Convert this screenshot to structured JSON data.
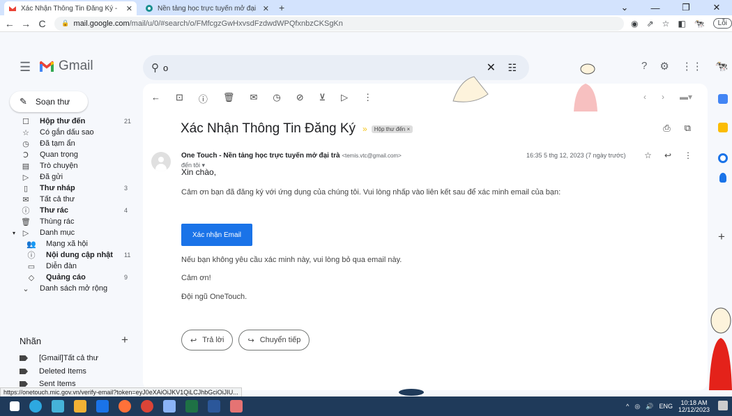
{
  "browser": {
    "tabs": [
      {
        "title": "Xác Nhận Thông Tin Đăng Ký - ",
        "active": true
      },
      {
        "title": "Nền tảng học trực tuyến mở đại",
        "active": false
      }
    ],
    "url_host": "mail.google.com",
    "url_path": "/mail/u/0/#search/o/FMfcgzGwHxvsdFzdwdWPQfxnbzCKSgKn",
    "error_button": "Lỗi"
  },
  "gmail": {
    "logo_text": "Gmail",
    "search_value": "o",
    "compose_label": "Soạn thư",
    "nav": [
      {
        "icon": "inbox-icon",
        "glyph": "☐",
        "label": "Hộp thư đến",
        "count": "21",
        "bold": true
      },
      {
        "icon": "star-icon",
        "glyph": "☆",
        "label": "Có gắn dấu sao",
        "count": "",
        "bold": false
      },
      {
        "icon": "clock-icon",
        "glyph": "◷",
        "label": "Đã tạm ẩn",
        "count": "",
        "bold": false
      },
      {
        "icon": "important-icon",
        "glyph": "Ↄ",
        "label": "Quan trọng",
        "count": "",
        "bold": false
      },
      {
        "icon": "chat-icon",
        "glyph": "▤",
        "label": "Trò chuyện",
        "count": "",
        "bold": false
      },
      {
        "icon": "send-icon",
        "glyph": "▷",
        "label": "Đã gửi",
        "count": "",
        "bold": false
      },
      {
        "icon": "draft-icon",
        "glyph": "▯",
        "label": "Thư nháp",
        "count": "3",
        "bold": true
      },
      {
        "icon": "all-mail-icon",
        "glyph": "✉",
        "label": "Tất cả thư",
        "count": "",
        "bold": false
      },
      {
        "icon": "spam-icon",
        "glyph": "ⓘ",
        "label": "Thư rác",
        "count": "4",
        "bold": true
      },
      {
        "icon": "trash-icon",
        "glyph": "🗑",
        "label": "Thùng rác",
        "count": "",
        "bold": false
      },
      {
        "icon": "category-icon",
        "glyph": "▷",
        "label": "Danh mục",
        "count": "",
        "bold": false
      }
    ],
    "categories": [
      {
        "icon": "social-icon",
        "glyph": "👥",
        "label": "Mạng xã hội",
        "count": "",
        "bold": false
      },
      {
        "icon": "updates-icon",
        "glyph": "ⓘ",
        "label": "Nội dung cập nhật",
        "count": "11",
        "bold": true
      },
      {
        "icon": "forum-icon",
        "glyph": "▭",
        "label": "Diễn đàn",
        "count": "",
        "bold": false
      },
      {
        "icon": "promo-icon",
        "glyph": "◇",
        "label": "Quảng cáo",
        "count": "9",
        "bold": true
      }
    ],
    "expand_label": "Danh sách mở rộng",
    "labels_heading": "Nhãn",
    "labels": [
      "[Gmail]Tất cả thư",
      "Deleted Items",
      "Sent Items"
    ]
  },
  "email": {
    "subject": "Xác Nhận Thông Tin Đăng Ký",
    "folder_badge": "Hộp thư đến ×",
    "sender_name": "One Touch - Nền tảng học trực tuyến mở đại trà",
    "sender_email": "<temis.vtc@gmail.com>",
    "to_me": "đến tôi ▾",
    "datetime": "16:35 5 thg 12, 2023 (7 ngày trước)",
    "greeting": "Xin chào,",
    "line1": "Cảm ơn bạn đã đăng ký với ứng dụng của chúng tôi. Vui lòng nhấp vào liên kết sau để xác minh email của bạn:",
    "confirm_button": "Xác nhận Email",
    "line2": "Nếu bạn không yêu cầu xác minh này, vui lòng bỏ qua email này.",
    "thanks": "Cảm ơn!",
    "signature": "Đội ngũ OneTouch.",
    "reply_label": "Trả lời",
    "forward_label": "Chuyển tiếp"
  },
  "status_url": "https://onetouch.mic.gov.vn/verify-email?token=eyJ0eXAiOiJKV1QiLCJhbGciOiJIU...",
  "taskbar": {
    "lang": "ENG",
    "time": "10:18 AM",
    "date": "12/12/2023"
  },
  "colors": {
    "accent": "#1a73e8",
    "gmail_red": "#ea4335",
    "tab_bar": "#d3e3fd",
    "taskbar": "#1f3a5a"
  }
}
